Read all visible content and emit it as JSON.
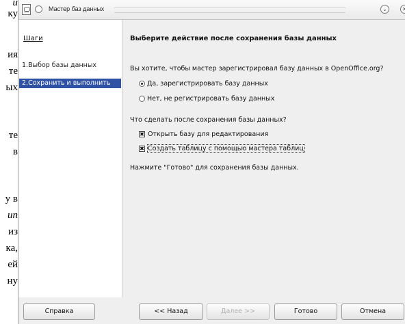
{
  "background_doc": {
    "lines": [
      "и",
      "ку",
      "ия",
      "те",
      "ых",
      "те",
      "в",
      "у в",
      "ип",
      "из",
      "ка,",
      "ей",
      "ну"
    ]
  },
  "window": {
    "title": "Мастер баз данных",
    "more_glyph": "⌄",
    "close_glyph": "✕"
  },
  "steps": {
    "heading": "Шаги",
    "items": [
      {
        "label": "1.Выбор базы данных",
        "active": false
      },
      {
        "label": "2.Сохранить и выполнить",
        "active": true
      }
    ]
  },
  "main": {
    "title": "Выберите действие после сохранения базы данных",
    "register_question": "Вы хотите, чтобы мастер зарегистрировал базу данных в OpenOffice.org?",
    "register_yes": "Да, зарегистрировать базу данных",
    "register_no": "Нет, не регистрировать базу данных",
    "register_selected": "yes",
    "after_question": "Что сделать после сохранения базы данных?",
    "open_for_edit": "Открыть базу для редактирования",
    "open_for_edit_checked": true,
    "create_table": "Создать таблицу с помощью мастера таблиц",
    "create_table_checked": true,
    "finish_hint": "Нажмите \"Готово\" для сохранения базы данных.",
    "check_glyph": "✖"
  },
  "buttons": {
    "help": "Справка",
    "back": "<< Назад",
    "next": "Далее >>",
    "finish": "Готово",
    "cancel": "Отмена"
  }
}
